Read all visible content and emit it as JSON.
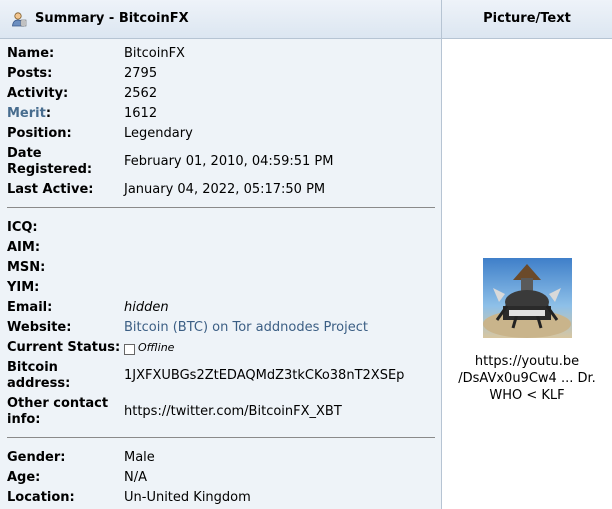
{
  "header": {
    "left_title": "Summary - BitcoinFX",
    "right_title": "Picture/Text"
  },
  "fields": {
    "name": {
      "label": "Name:",
      "value": "BitcoinFX"
    },
    "posts": {
      "label": "Posts:",
      "value": "2795"
    },
    "activity": {
      "label": "Activity:",
      "value": "2562"
    },
    "merit": {
      "label": "Merit",
      "colon": ":",
      "value": "1612"
    },
    "position": {
      "label": "Position:",
      "value": "Legendary"
    },
    "date_registered": {
      "label_line1": "Date",
      "label_line2": "Registered:",
      "value": "February 01, 2010, 04:59:51 PM"
    },
    "last_active": {
      "label": "Last Active:",
      "value": "January 04, 2022, 05:17:50 PM"
    },
    "icq": {
      "label": "ICQ:"
    },
    "aim": {
      "label": "AIM:"
    },
    "msn": {
      "label": "MSN:"
    },
    "yim": {
      "label": "YIM:"
    },
    "email": {
      "label": "Email:",
      "value": "hidden"
    },
    "website": {
      "label": "Website:",
      "value": "Bitcoin (BTC) on Tor addnodes Project"
    },
    "current_status": {
      "label": "Current Status:",
      "value": "Offline"
    },
    "bitcoin_address": {
      "label_line1": "Bitcoin",
      "label_line2": "address:",
      "value": "1JXFXUBGs2ZtEDAQMdZ3tkCKo38nT2XSEp"
    },
    "other_contact": {
      "label_line1": "Other contact",
      "label_line2": "info:",
      "value": "https://twitter.com/BitcoinFX_XBT"
    },
    "gender": {
      "label": "Gender:",
      "value": "Male"
    },
    "age": {
      "label": "Age:",
      "value": "N/A"
    },
    "location": {
      "label": "Location:",
      "value": "Un-United Kingdom"
    }
  },
  "picture": {
    "text_line1": "https://youtu.be",
    "text_line2": "/DsAVx0u9Cw4 ... Dr.",
    "text_line3": "WHO < KLF"
  },
  "colors": {
    "header_bg": "#dce6f1",
    "panel_bg": "#eef3f8",
    "link": "#3b5e84",
    "merit_label": "#476c8e"
  }
}
